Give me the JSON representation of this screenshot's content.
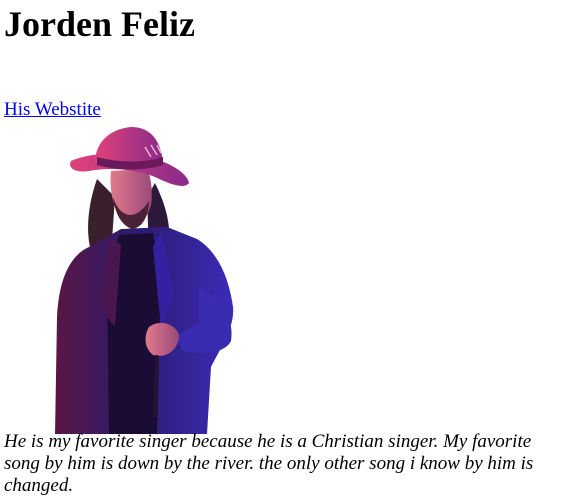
{
  "page": {
    "title": "Jorden Feliz",
    "website_link": "His Webstite",
    "photo": {
      "subject": "singer-photo",
      "colors": {
        "hat": "#c43a7c",
        "jacket": "#2a1b6e",
        "shirt": "#1a0d36",
        "hair": "#3a2030",
        "skin": "#d98a8a"
      }
    },
    "caption": "He is my favorite singer because he is a Christian singer. My favorite song by him is down by the river. the only other song i know by him is changed."
  }
}
